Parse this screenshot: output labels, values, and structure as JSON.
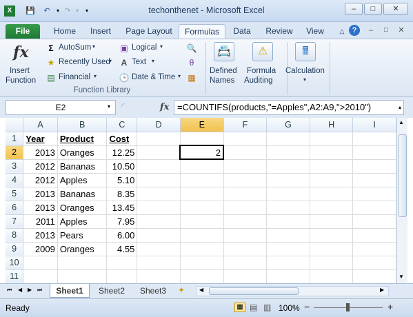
{
  "window": {
    "title": "techonthenet - Microsoft Excel",
    "min_label": "–",
    "max_label": "□",
    "close_label": "✕"
  },
  "tabs": [
    {
      "label": "File"
    },
    {
      "label": "Home"
    },
    {
      "label": "Insert"
    },
    {
      "label": "Page Layout"
    },
    {
      "label": "Formulas"
    },
    {
      "label": "Data"
    },
    {
      "label": "Review"
    },
    {
      "label": "View"
    }
  ],
  "ribbon": {
    "insert_function": {
      "line1": "Insert",
      "line2": "Function",
      "icon_text": "fx"
    },
    "autosum": "AutoSum",
    "recently_used": "Recently Used",
    "financial": "Financial",
    "logical": "Logical",
    "text": "Text",
    "date_time": "Date & Time",
    "function_library_label": "Function Library",
    "defined_names": {
      "line1": "Defined",
      "line2": "Names"
    },
    "formula_auditing": {
      "line1": "Formula",
      "line2": "Auditing"
    },
    "calculation": "Calculation"
  },
  "formula_bar": {
    "name_box": "E2",
    "fx_label": "fx",
    "formula": "=COUNTIFS(products,\"=Apples\",A2:A9,\">2010\")"
  },
  "grid": {
    "columns": [
      "A",
      "B",
      "C",
      "D",
      "E",
      "F",
      "G",
      "H",
      "I"
    ],
    "rows": [
      [
        "Year",
        "Product",
        "Cost",
        "",
        "",
        "",
        "",
        "",
        ""
      ],
      [
        "2013",
        "Oranges",
        "12.25",
        "",
        "2",
        "",
        "",
        "",
        ""
      ],
      [
        "2012",
        "Bananas",
        "10.50",
        "",
        "",
        "",
        "",
        "",
        ""
      ],
      [
        "2012",
        "Apples",
        "5.10",
        "",
        "",
        "",
        "",
        "",
        ""
      ],
      [
        "2013",
        "Bananas",
        "8.35",
        "",
        "",
        "",
        "",
        "",
        ""
      ],
      [
        "2013",
        "Oranges",
        "13.45",
        "",
        "",
        "",
        "",
        "",
        ""
      ],
      [
        "2011",
        "Apples",
        "7.95",
        "",
        "",
        "",
        "",
        "",
        ""
      ],
      [
        "2013",
        "Pears",
        "6.00",
        "",
        "",
        "",
        "",
        "",
        ""
      ],
      [
        "2009",
        "Oranges",
        "4.55",
        "",
        "",
        "",
        "",
        "",
        ""
      ],
      [
        "",
        "",
        "",
        "",
        "",
        "",
        "",
        "",
        ""
      ],
      [
        "",
        "",
        "",
        "",
        "",
        "",
        "",
        "",
        ""
      ],
      [
        "",
        "",
        "",
        "",
        "",
        "",
        "",
        "",
        ""
      ]
    ],
    "row_numbers": [
      "1",
      "2",
      "3",
      "4",
      "5",
      "6",
      "7",
      "8",
      "9",
      "10",
      "11",
      "12"
    ],
    "active_cell": "E2"
  },
  "sheets": [
    "Sheet1",
    "Sheet2",
    "Sheet3"
  ],
  "status": {
    "ready": "Ready",
    "zoom": "100%",
    "minus": "−",
    "plus": "+"
  }
}
